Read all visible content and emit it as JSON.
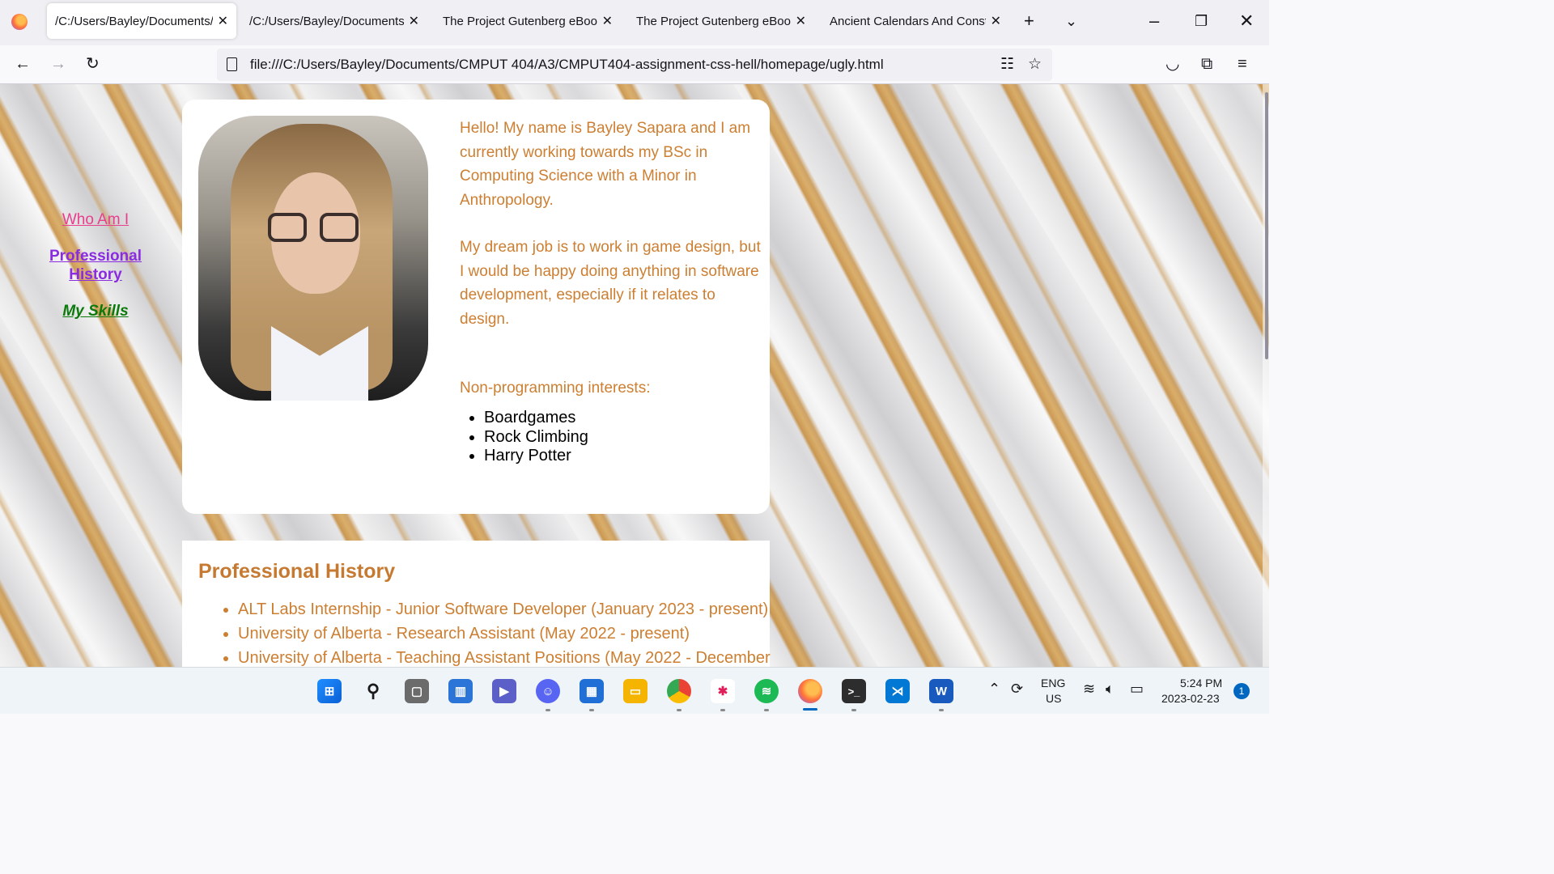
{
  "browser": {
    "tabs": [
      {
        "title": "/C:/Users/Bayley/Documents/C",
        "active": true
      },
      {
        "title": "/C:/Users/Bayley/Documents/C",
        "active": false
      },
      {
        "title": "The Project Gutenberg eBook",
        "active": false
      },
      {
        "title": "The Project Gutenberg eBook",
        "active": false
      },
      {
        "title": "Ancient Calendars And Conste",
        "active": false
      }
    ],
    "url": "file:///C:/Users/Bayley/Documents/CMPUT 404/A3/CMPUT404-assignment-css-hell/homepage/ugly.html"
  },
  "page": {
    "sidenav": {
      "who": "Who Am I",
      "history": "Professional History",
      "skills": "My Skills"
    },
    "intro_p1": "Hello! My name is Bayley Sapara and I am currently working towards my BSc in Computing Science with a Minor in Anthropology.",
    "intro_p2": "My dream job is to work in game design, but I would be happy doing anything in software development, especially if it relates to design.",
    "interests_heading": "Non-programming interests:",
    "interests": [
      "Boardgames",
      "Rock Climbing",
      "Harry Potter"
    ],
    "history_heading": "Professional History",
    "history": [
      "ALT Labs Internship - Junior Software Developer (January 2023 - present)",
      "University of Alberta - Research Assistant (May 2022 - present)",
      "University of Alberta - Teaching Assistant Positions (May 2022 - December"
    ]
  },
  "taskbar": {
    "lang_top": "ENG",
    "lang_bottom": "US",
    "time": "5:24 PM",
    "date": "2023-02-23",
    "notifications": "1"
  }
}
